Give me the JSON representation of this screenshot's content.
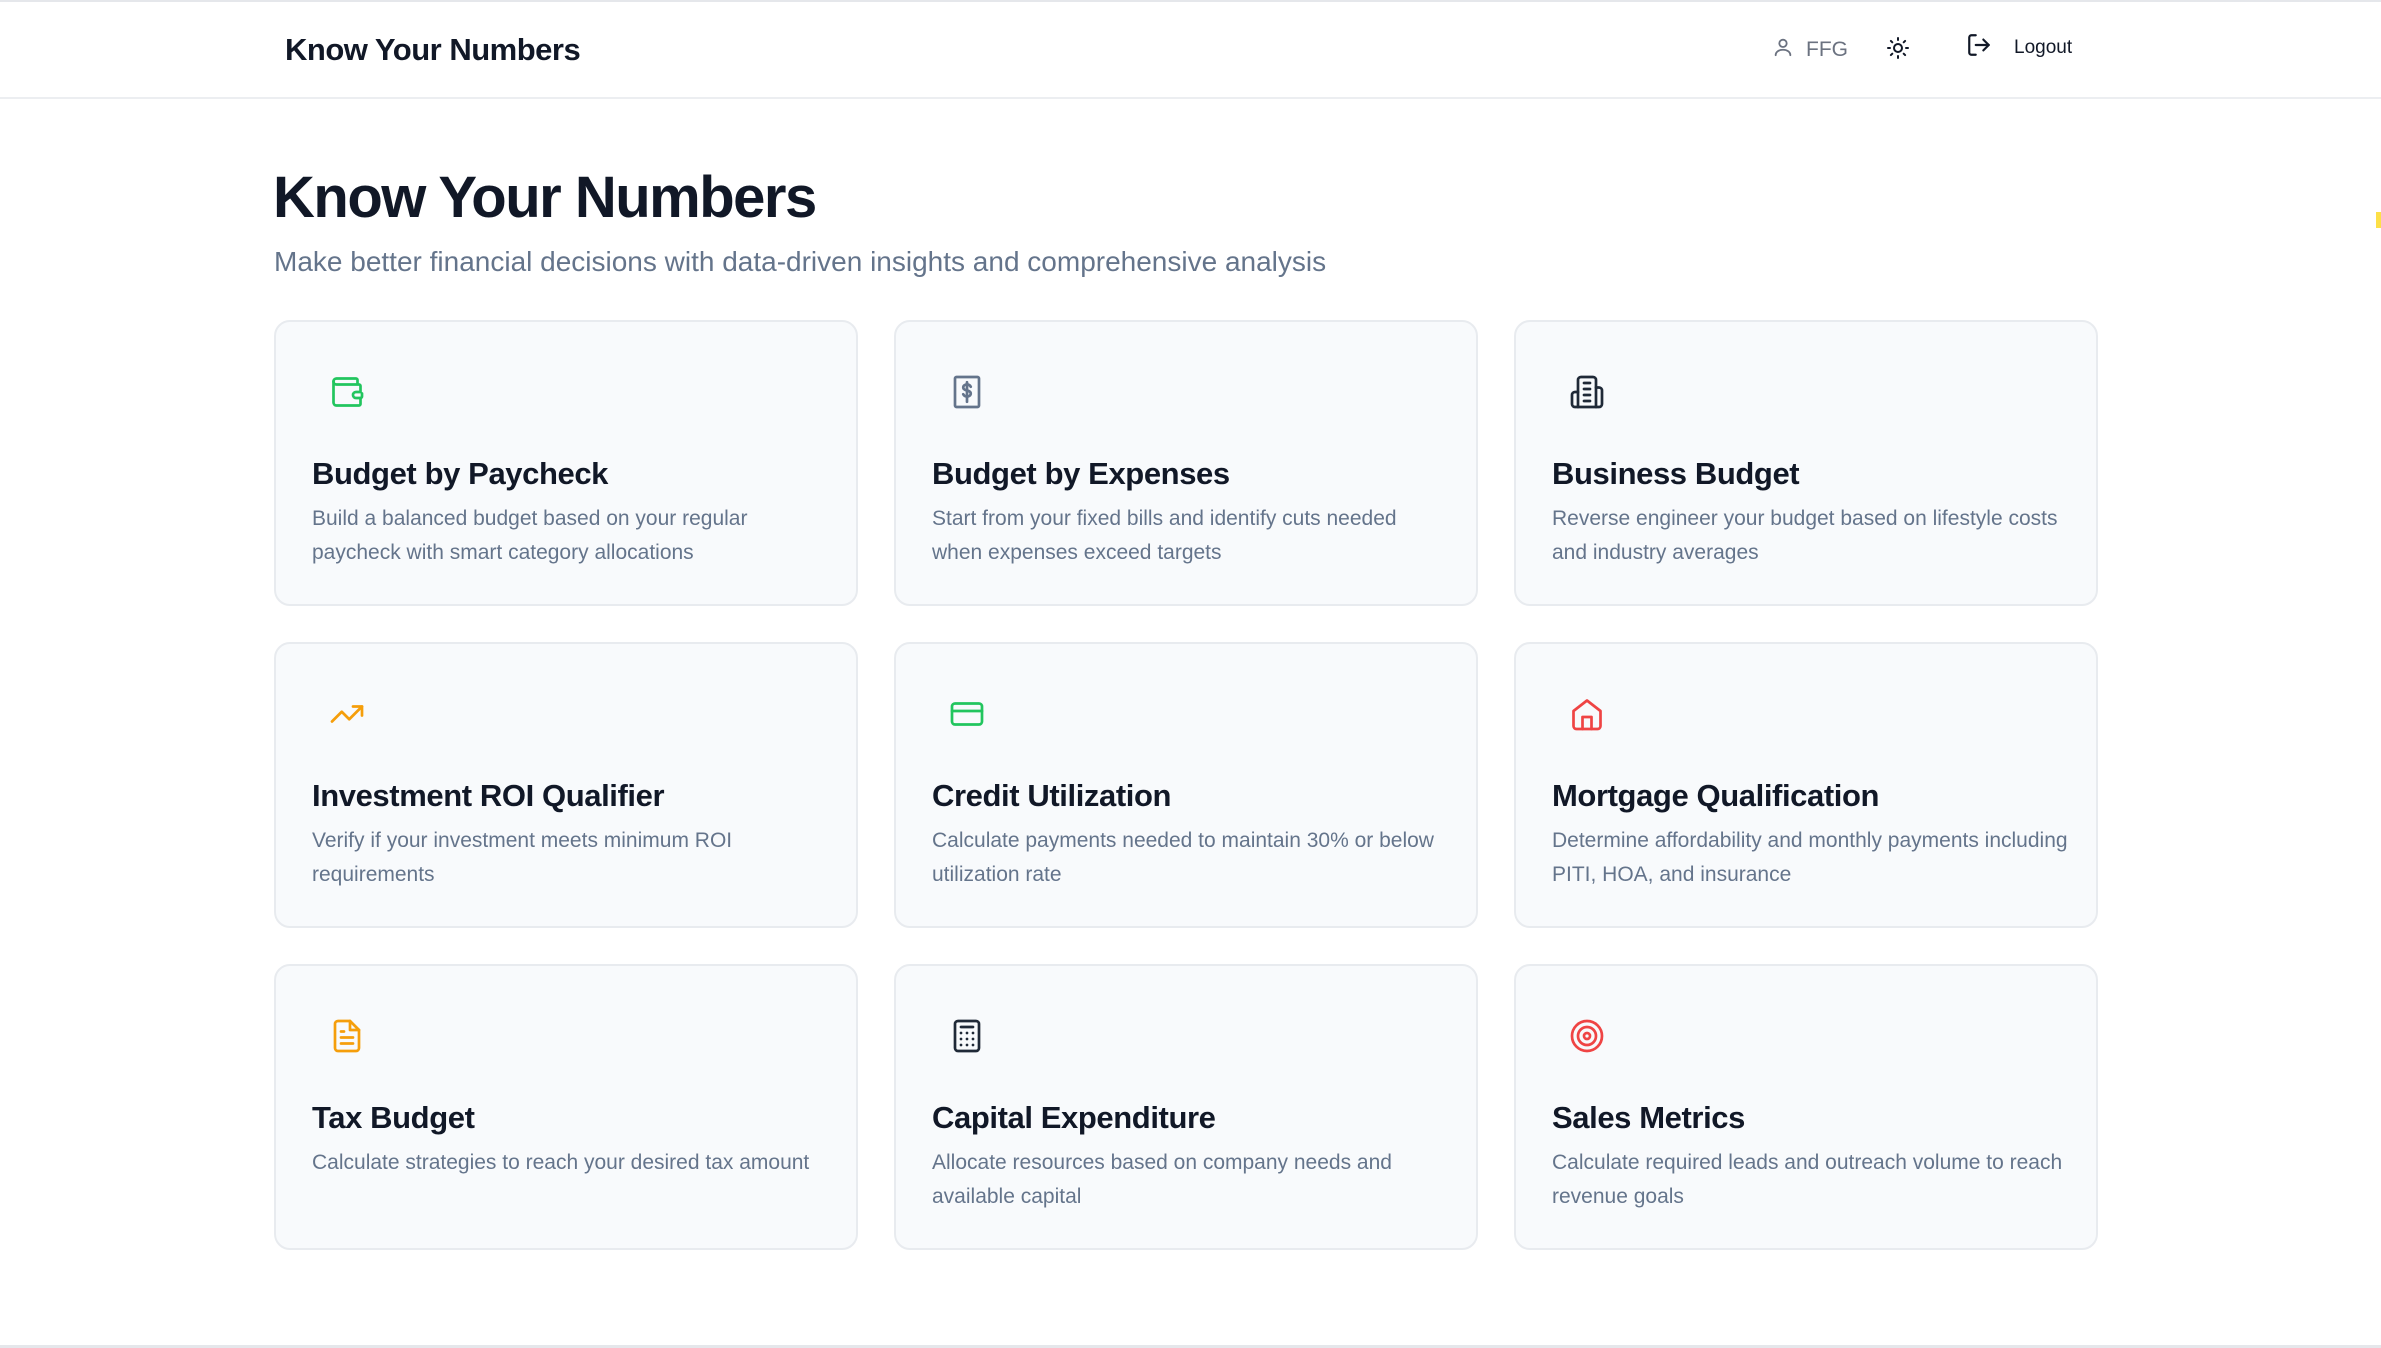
{
  "header": {
    "brand": "Know Your Numbers",
    "user_label": "FFG",
    "logout_label": "Logout"
  },
  "hero": {
    "title": "Know Your Numbers",
    "subtitle": "Make better financial decisions with data-driven insights and comprehensive analysis"
  },
  "colors": {
    "green": "#22c55e",
    "slate": "#64748b",
    "dark": "#1f2937",
    "orange": "#f59e0b",
    "red": "#ef4444"
  },
  "cards": [
    {
      "icon": "wallet-icon",
      "icon_color": "#22c55e",
      "title": "Budget by Paycheck",
      "description": "Build a balanced budget based on your regular paycheck with smart category allocations"
    },
    {
      "icon": "receipt-icon",
      "icon_color": "#64748b",
      "title": "Budget by Expenses",
      "description": "Start from your fixed bills and identify cuts needed when expenses exceed targets"
    },
    {
      "icon": "building-icon",
      "icon_color": "#1f2937",
      "title": "Business Budget",
      "description": "Reverse engineer your budget based on lifestyle costs and industry averages"
    },
    {
      "icon": "trending-up-icon",
      "icon_color": "#f59e0b",
      "title": "Investment ROI Qualifier",
      "description": "Verify if your investment meets minimum ROI requirements"
    },
    {
      "icon": "credit-card-icon",
      "icon_color": "#22c55e",
      "title": "Credit Utilization",
      "description": "Calculate payments needed to maintain 30% or below utilization rate"
    },
    {
      "icon": "house-icon",
      "icon_color": "#ef4444",
      "title": "Mortgage Qualification",
      "description": "Determine affordability and monthly payments including PITI, HOA, and insurance"
    },
    {
      "icon": "file-text-icon",
      "icon_color": "#f59e0b",
      "title": "Tax Budget",
      "description": "Calculate strategies to reach your desired tax amount"
    },
    {
      "icon": "calculator-icon",
      "icon_color": "#1f2937",
      "title": "Capital Expenditure",
      "description": "Allocate resources based on company needs and available capital"
    },
    {
      "icon": "target-icon",
      "icon_color": "#ef4444",
      "title": "Sales Metrics",
      "description": "Calculate required leads and outreach volume to reach revenue goals"
    }
  ]
}
